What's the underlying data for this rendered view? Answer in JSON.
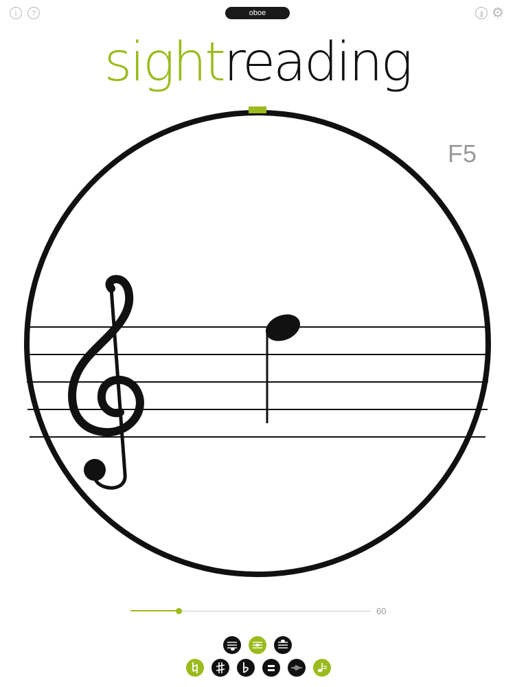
{
  "instrument": "oboe",
  "title": {
    "part1": "sight",
    "part2": "reading"
  },
  "current_note": "F5",
  "tempo": {
    "value": "60",
    "fraction": 0.2
  },
  "colors": {
    "accent": "#9bbb1d",
    "dark": "#111111",
    "muted": "#9a9a9a"
  },
  "icons": {
    "top_left": [
      "info-icon",
      "help-icon"
    ],
    "top_right": [
      "stats-icon",
      "gear-icon"
    ],
    "row1": [
      "range-low-icon",
      "range-mid-icon",
      "range-high-icon"
    ],
    "row2": [
      "natural-icon",
      "sharp-icon",
      "flat-icon",
      "pause-icon",
      "microphone-signal-icon",
      "metronome-icon"
    ]
  },
  "controls_state": {
    "row1_active": "range-mid",
    "row2_active": [
      "natural",
      "metronome"
    ]
  }
}
